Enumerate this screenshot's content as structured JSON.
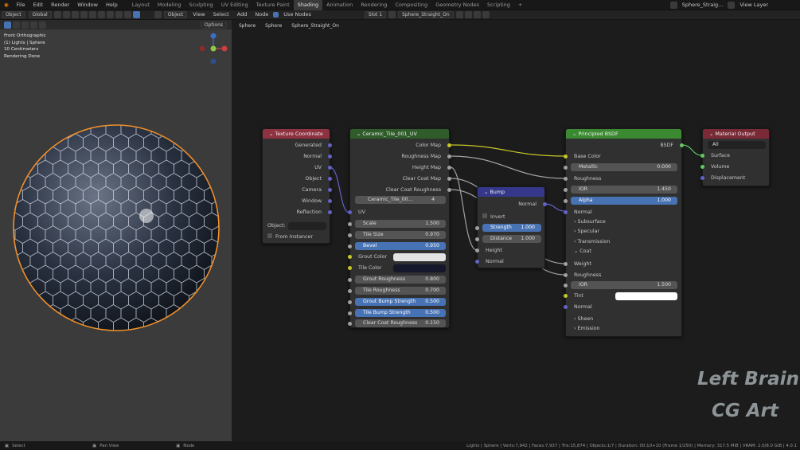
{
  "menu": [
    "File",
    "Edit",
    "Render",
    "Window",
    "Help"
  ],
  "workspaces": [
    "Layout",
    "Modeling",
    "Sculpting",
    "UV Editing",
    "Texture Paint",
    "Shading",
    "Animation",
    "Rendering",
    "Compositing",
    "Geometry Nodes",
    "Scripting"
  ],
  "active_workspace": "Shading",
  "add_tab": "+",
  "scene": "Sphere_Straig...",
  "view_layer": "View Layer",
  "viewport": {
    "mode": "Object",
    "orientation": "Global",
    "options": "Options",
    "overlay": [
      "Front Orthographic",
      "(1) Lights | Sphere",
      "10 Centimeters",
      "Rendering Done"
    ]
  },
  "editor": {
    "object_menu": "Object",
    "menus": [
      "View",
      "Select",
      "Add",
      "Node"
    ],
    "use_nodes": "Use Nodes",
    "slot": "Slot 1",
    "material": "Sphere_Straight_On"
  },
  "breadcrumb": [
    "Sphere",
    "Sphere",
    "Sphere_Straight_On"
  ],
  "nodes": {
    "texcoord": {
      "title": "Texture Coordinate",
      "outputs": [
        "Generated",
        "Normal",
        "UV",
        "Object",
        "Camera",
        "Window",
        "Reflection"
      ],
      "object_label": "Object:",
      "from_instancer": "From Instancer"
    },
    "group": {
      "title": "Ceramic_Tile_001_UV",
      "outputs": [
        "Color Map",
        "Roughness Map",
        "Height Map",
        "Clear Coat Map",
        "Clear Coat Roughness"
      ],
      "uv": "UV",
      "datablock": "Ceramic_Tile_00...",
      "users": "4",
      "fields": [
        {
          "label": "Scale",
          "value": "1.500"
        },
        {
          "label": "Tile Size",
          "value": "0.970"
        },
        {
          "label": "Bevel",
          "value": "0.950"
        }
      ],
      "colors": [
        {
          "label": "Grout Color",
          "hex": "#e3e3e3"
        },
        {
          "label": "Tile Color",
          "hex": "#15172a"
        }
      ],
      "fields2": [
        {
          "label": "Grout Roughness",
          "value": "0.800"
        },
        {
          "label": "Tile Roughness",
          "value": "0.700"
        },
        {
          "label": "Grout Bump Strength",
          "value": "0.500"
        },
        {
          "label": "Tile Bump Strength",
          "value": "0.500"
        },
        {
          "label": "Clear Coat Roughness",
          "value": "0.150"
        }
      ]
    },
    "bump": {
      "title": "Bump",
      "out": "Normal",
      "invert": "Invert",
      "strength_label": "Strength",
      "strength": "1.000",
      "distance_label": "Distance",
      "distance": "1.000",
      "height": "Height",
      "normal": "Normal"
    },
    "bsdf": {
      "title": "Principled BSDF",
      "out": "BSDF",
      "base_color": "Base Color",
      "metallic_label": "Metallic",
      "metallic": "0.000",
      "roughness": "Roughness",
      "ior_label": "IOR",
      "ior": "1.450",
      "alpha_label": "Alpha",
      "alpha": "1.000",
      "normal": "Normal",
      "subsurface": "Subsurface",
      "specular": "Specular",
      "transmission": "Transmission",
      "coat": "Coat",
      "weight": "Weight",
      "coat_roughness": "Roughness",
      "coat_ior_label": "IOR",
      "coat_ior": "1.500",
      "tint": "Tint",
      "coat_normal": "Normal",
      "sheen": "Sheen",
      "emission": "Emission"
    },
    "output": {
      "title": "Material Output",
      "target": "All",
      "inputs": [
        "Surface",
        "Volume",
        "Displacement"
      ]
    }
  },
  "status": {
    "select": "Select",
    "pan": "Pan View",
    "node": "Node",
    "stats": "Lights | Sphere | Verts:7,942 | Faces:7,937 | Tris:15,874 | Objects:1/7 | Duration: 00:10+10 (Frame 1/250) | Memory: 317.5 MiB | VRAM: 2.0/8.0 GiB | 4.0.1"
  },
  "watermark": [
    "Left Brain",
    "CG Art"
  ],
  "colors": {
    "tex_header": "#8e3140",
    "shader_header": "#3b8a31",
    "output_header": "#7a2a37",
    "group_header": "#2f5c2a",
    "vector_header": "#35388a",
    "select_blue": "#4772b3"
  }
}
